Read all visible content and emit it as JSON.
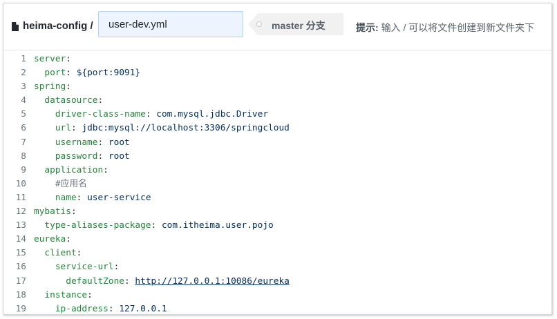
{
  "toolbar": {
    "repo_name": "heima-config",
    "separator": "/",
    "filename_value": "user-dev.yml",
    "branch_label": "master 分支",
    "hint_label": "提示:",
    "hint_text": "输入 / 可以将文件创建到新文件夹下"
  },
  "editor": {
    "lines": [
      {
        "num": "1",
        "key": "server",
        "indent": "",
        "value": ""
      },
      {
        "num": "2",
        "key": "port",
        "indent": "  ",
        "value": "${port:9091}"
      },
      {
        "num": "3",
        "key": "spring",
        "indent": "",
        "value": ""
      },
      {
        "num": "4",
        "key": "datasource",
        "indent": "  ",
        "value": ""
      },
      {
        "num": "5",
        "key": "driver-class-name",
        "indent": "    ",
        "value": "com.mysql.jdbc.Driver"
      },
      {
        "num": "6",
        "key": "url",
        "indent": "    ",
        "value": "jdbc:mysql://localhost:3306/springcloud"
      },
      {
        "num": "7",
        "key": "username",
        "indent": "    ",
        "value": "root"
      },
      {
        "num": "8",
        "key": "password",
        "indent": "    ",
        "value": "root"
      },
      {
        "num": "9",
        "key": "application",
        "indent": "  ",
        "value": ""
      },
      {
        "num": "10",
        "comment": "#应用名",
        "indent": "    "
      },
      {
        "num": "11",
        "key": "name",
        "indent": "    ",
        "value": "user-service"
      },
      {
        "num": "12",
        "key": "mybatis",
        "indent": "",
        "value": ""
      },
      {
        "num": "13",
        "key": "type-aliases-package",
        "indent": "  ",
        "value": "com.itheima.user.pojo"
      },
      {
        "num": "14",
        "key": "eureka",
        "indent": "",
        "value": ""
      },
      {
        "num": "15",
        "key": "client",
        "indent": "  ",
        "value": ""
      },
      {
        "num": "16",
        "key": "service-url",
        "indent": "    ",
        "value": ""
      },
      {
        "num": "17",
        "key": "defaultZone",
        "indent": "      ",
        "value": "http://127.0.0.1:10086/eureka",
        "link": true
      },
      {
        "num": "18",
        "key": "instance",
        "indent": "  ",
        "value": ""
      },
      {
        "num": "19",
        "key": "ip-address",
        "indent": "    ",
        "value": "127.0.0.1"
      }
    ]
  },
  "colors": {
    "key": "#22863a",
    "value": "#032f62",
    "comment": "#6a737d",
    "line_number": "#6a737d",
    "input_bg": "#eef4fd"
  }
}
